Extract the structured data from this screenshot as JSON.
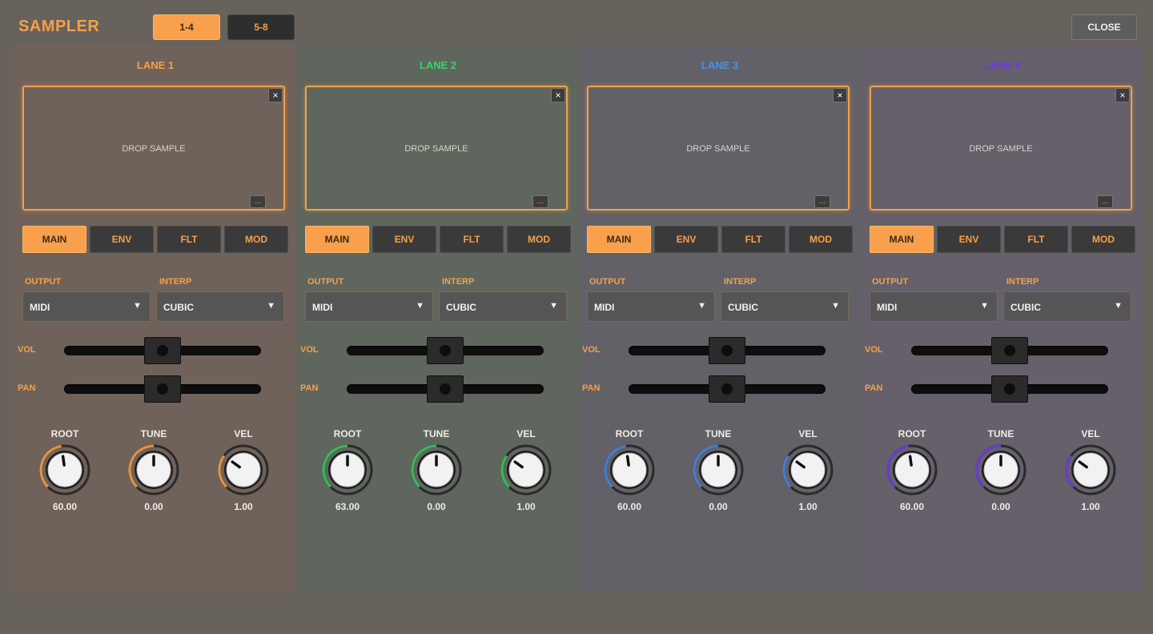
{
  "header": {
    "title": "SAMPLER",
    "pages": [
      "1-4",
      "5-8"
    ],
    "active_page": 0,
    "close_label": "CLOSE"
  },
  "common": {
    "drop_label": "DROP SAMPLE",
    "close_x": "×",
    "more": "...",
    "tabs": [
      "MAIN",
      "ENV",
      "FLT",
      "MOD"
    ],
    "output_label": "OUTPUT",
    "interp_label": "INTERP",
    "vol_label": "VOL",
    "pan_label": "PAN",
    "knob_labels": [
      "ROOT",
      "TUNE",
      "VEL"
    ],
    "select_arrow": "▼"
  },
  "lanes": [
    {
      "title": "LANE 1",
      "title_color": "#f5a04a",
      "ring_color": "#e8943f",
      "bg": "#6f625a",
      "active_tab": 0,
      "output": "MIDI",
      "interp": "CUBIC",
      "vol": 0.5,
      "pan": 0.5,
      "knobs": [
        {
          "value": "60.00",
          "level": 0.47
        },
        {
          "value": "0.00",
          "level": 0.5
        },
        {
          "value": "1.00",
          "level": 0.3
        }
      ]
    },
    {
      "title": "LANE 2",
      "title_color": "#3fcf6a",
      "ring_color": "#2fbf5a",
      "bg": "#5f665d",
      "active_tab": 0,
      "output": "MIDI",
      "interp": "CUBIC",
      "vol": 0.5,
      "pan": 0.5,
      "knobs": [
        {
          "value": "63.00",
          "level": 0.5
        },
        {
          "value": "0.00",
          "level": 0.5
        },
        {
          "value": "1.00",
          "level": 0.3
        }
      ]
    },
    {
      "title": "LANE 3",
      "title_color": "#4a90e8",
      "ring_color": "#3f7fd8",
      "bg": "#626168",
      "active_tab": 0,
      "output": "MIDI",
      "interp": "CUBIC",
      "vol": 0.5,
      "pan": 0.5,
      "knobs": [
        {
          "value": "60.00",
          "level": 0.47
        },
        {
          "value": "0.00",
          "level": 0.5
        },
        {
          "value": "1.00",
          "level": 0.3
        }
      ]
    },
    {
      "title": "LANE 4",
      "title_color": "#6a3ae0",
      "ring_color": "#6a3ad8",
      "bg": "#65606a",
      "active_tab": 0,
      "output": "MIDI",
      "interp": "CUBIC",
      "vol": 0.5,
      "pan": 0.5,
      "knobs": [
        {
          "value": "60.00",
          "level": 0.47
        },
        {
          "value": "0.00",
          "level": 0.5
        },
        {
          "value": "1.00",
          "level": 0.3
        }
      ]
    }
  ]
}
